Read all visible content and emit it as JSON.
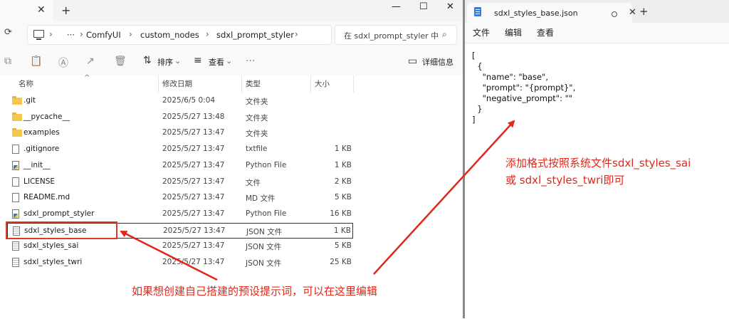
{
  "explorer": {
    "tab_close": "✕",
    "new_tab": "+",
    "window_controls": [
      "—",
      "☐",
      "✕"
    ],
    "breadcrumb": [
      "ComfyUI",
      "custom_nodes",
      "sdxl_prompt_styler"
    ],
    "breadcrumb_more": "···",
    "search_placeholder": "在 sdxl_prompt_styler 中",
    "toolbar": {
      "sort": "排序",
      "view": "查看",
      "details": "详细信息"
    },
    "columns": {
      "name": "名称",
      "modified": "修改日期",
      "type": "类型",
      "size": "大小"
    },
    "files": [
      {
        "name": ".git",
        "date": "2025/6/5 0:04",
        "type": "文件夹",
        "size": "",
        "icon": "folder-icon"
      },
      {
        "name": "__pycache__",
        "date": "2025/5/27 13:48",
        "type": "文件夹",
        "size": "",
        "icon": "folder-icon"
      },
      {
        "name": "examples",
        "date": "2025/5/27 13:47",
        "type": "文件夹",
        "size": "",
        "icon": "folder-icon"
      },
      {
        "name": ".gitignore",
        "date": "2025/5/27 13:47",
        "type": "txtfile",
        "size": "1 KB",
        "icon": "file-icon"
      },
      {
        "name": "__init__",
        "date": "2025/5/27 13:47",
        "type": "Python File",
        "size": "1 KB",
        "icon": "python-file-icon"
      },
      {
        "name": "LICENSE",
        "date": "2025/5/27 13:47",
        "type": "文件",
        "size": "2 KB",
        "icon": "file-icon"
      },
      {
        "name": "README.md",
        "date": "2025/5/27 13:47",
        "type": "MD 文件",
        "size": "5 KB",
        "icon": "file-icon"
      },
      {
        "name": "sdxl_prompt_styler",
        "date": "2025/5/27 13:47",
        "type": "Python File",
        "size": "16 KB",
        "icon": "python-file-icon"
      },
      {
        "name": "sdxl_styles_base",
        "date": "2025/5/27 13:47",
        "type": "JSON 文件",
        "size": "1 KB",
        "icon": "json-file-icon"
      },
      {
        "name": "sdxl_styles_sai",
        "date": "2025/5/27 13:47",
        "type": "JSON 文件",
        "size": "5 KB",
        "icon": "json-file-icon"
      },
      {
        "name": "sdxl_styles_twri",
        "date": "2025/5/27 13:47",
        "type": "JSON 文件",
        "size": "25 KB",
        "icon": "json-file-icon"
      }
    ],
    "selected_index": 8
  },
  "notepad": {
    "tab_title": "sdxl_styles_base.json",
    "tab_close": "✕",
    "new_tab": "+",
    "menu": [
      "文件",
      "编辑",
      "查看"
    ],
    "content": "[\n  {\n    \"name\": \"base\",\n    \"prompt\": \"{prompt}\",\n    \"negative_prompt\": \"\"\n  }\n]"
  },
  "annotations": {
    "left_hint": "如果想创建自己搭建的预设提示词，可以在这里编辑",
    "right_hint_line1": "添加格式按照系统文件sdxl_styles_sai",
    "right_hint_line2": "或 sdxl_styles_twri即可",
    "color": "#e0281a"
  }
}
